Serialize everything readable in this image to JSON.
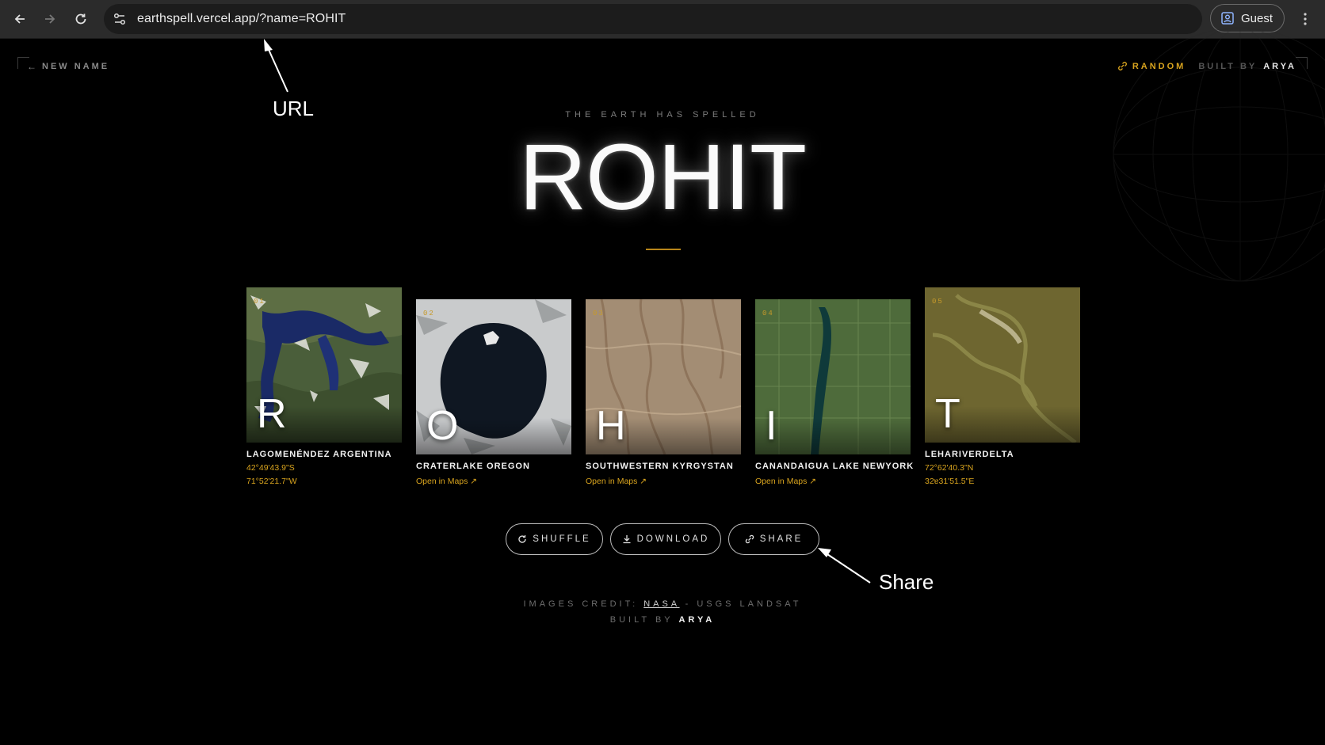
{
  "browser": {
    "url": "earthspell.vercel.app/?name=ROHIT",
    "profile_label": "Guest",
    "icons": [
      "back-arrow-icon",
      "forward-arrow-icon",
      "reload-icon",
      "site-settings-icon",
      "profile-icon",
      "kebab-menu-icon"
    ]
  },
  "header": {
    "new_name": "NEW NAME",
    "random": "RANDOM",
    "built_by_label": "BUILT BY",
    "built_by_name": "ARYA"
  },
  "hero": {
    "eyebrow": "THE EARTH HAS SPELLED",
    "name": "ROHIT"
  },
  "cards": [
    {
      "num": "01",
      "letter": "R",
      "title": "LAGOMENÉNDEZ ARGENTINA",
      "line1": "42°49'43.9\"S",
      "line2": "71°52'21.7\"W"
    },
    {
      "num": "02",
      "letter": "O",
      "title": "CRATERLAKE OREGON",
      "link": "Open in Maps ↗"
    },
    {
      "num": "03",
      "letter": "H",
      "title": "SOUTHWESTERN KYRGYSTAN",
      "link": "Open in Maps ↗"
    },
    {
      "num": "04",
      "letter": "I",
      "title": "CANANDAIGUA LAKE NEWYORK",
      "link": "Open in Maps ↗"
    },
    {
      "num": "05",
      "letter": "T",
      "title": "LEHARIVERDELTA",
      "line1": "72°62'40.3\"N",
      "line2": "32ɐ31'51.5\"E"
    }
  ],
  "actions": {
    "shuffle": "SHUFFLE",
    "download": "DOWNLOAD",
    "share": "SHARE"
  },
  "footer": {
    "credit_prefix": "IMAGES CREDIT: ",
    "credit_link": "NASA",
    "credit_suffix": " - USGS LANDSAT",
    "built_by_label": "BUILT BY ",
    "built_by_name": "ARYA"
  },
  "annotations": {
    "url_label": "URL",
    "share_label": "Share"
  },
  "colors": {
    "accent": "#d9a41e",
    "background": "#000000",
    "chrome": "#2b2b2b"
  }
}
